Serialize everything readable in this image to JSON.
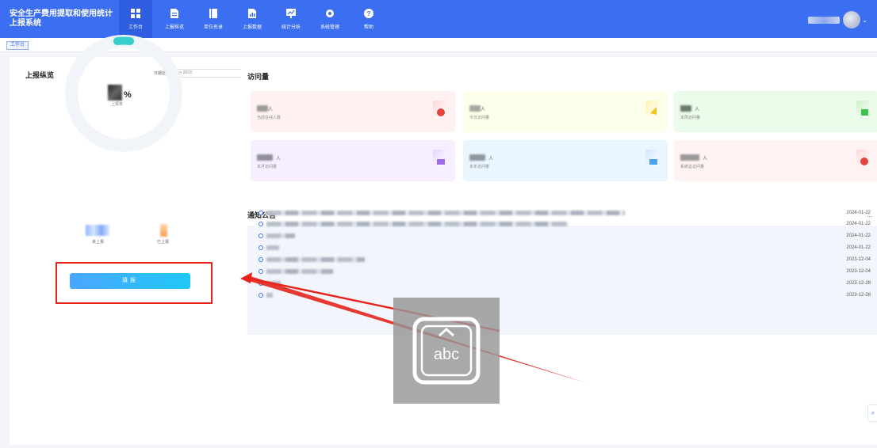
{
  "app": {
    "title_line1": "安全生产费用提取和使用统计",
    "title_line2": "上报系统"
  },
  "nav": {
    "items": [
      {
        "label": "工作台",
        "icon": "grid-icon",
        "active": true
      },
      {
        "label": "上报纵览",
        "icon": "document-icon"
      },
      {
        "label": "单位名录",
        "icon": "book-icon"
      },
      {
        "label": "上报数据",
        "icon": "data-document-icon"
      },
      {
        "label": "统计分析",
        "icon": "chart-icon"
      },
      {
        "label": "系统管理",
        "icon": "gear-icon"
      },
      {
        "label": "帮助",
        "icon": "help-icon"
      }
    ]
  },
  "breadcrumb": {
    "tab": "工作台"
  },
  "overview": {
    "title": "上报纵览",
    "date_label": "日期选择",
    "date_value": "2023",
    "percent_unit": "%",
    "rate_label": "上报率",
    "not_reported_label": "未上报",
    "reported_label": "已上报",
    "report_button": "填报"
  },
  "visits": {
    "title": "访问量",
    "cards": [
      {
        "unit": "人",
        "label": "当前在线人数",
        "color": "#fff1f1",
        "icon_color": "#e8423c"
      },
      {
        "unit": "人",
        "label": "今日访问量",
        "color": "#fcffea",
        "icon_color": "#f2c318"
      },
      {
        "unit": "人",
        "label": "本周访问量",
        "color": "#ebfbea",
        "icon_color": "#3ec24e"
      },
      {
        "unit": "人",
        "label": "本月访问量",
        "color": "#f7efff",
        "icon_color": "#a26ae6"
      },
      {
        "unit": "人",
        "label": "本年访问量",
        "color": "#eaf6ff",
        "icon_color": "#4aa3f0"
      },
      {
        "unit": "人",
        "label": "系统总访问量",
        "color": "#fff2f2",
        "icon_color": "#e8423c"
      }
    ]
  },
  "notices": {
    "title": "通知公告",
    "more": "...",
    "rows": [
      {
        "date": "2024-01-22"
      },
      {
        "date": "2024-01-22"
      },
      {
        "date": "2024-01-22"
      },
      {
        "date": "2024-01-22"
      },
      {
        "date": "2023-12-04"
      },
      {
        "date": "2023-12-04"
      },
      {
        "date": "2023-12-28"
      },
      {
        "date": "2023-12-28"
      }
    ]
  },
  "overlay": {
    "keyboard_text": "abc"
  },
  "colors": {
    "primary": "#3b6ef0",
    "annotation_red": "#e5231b"
  }
}
